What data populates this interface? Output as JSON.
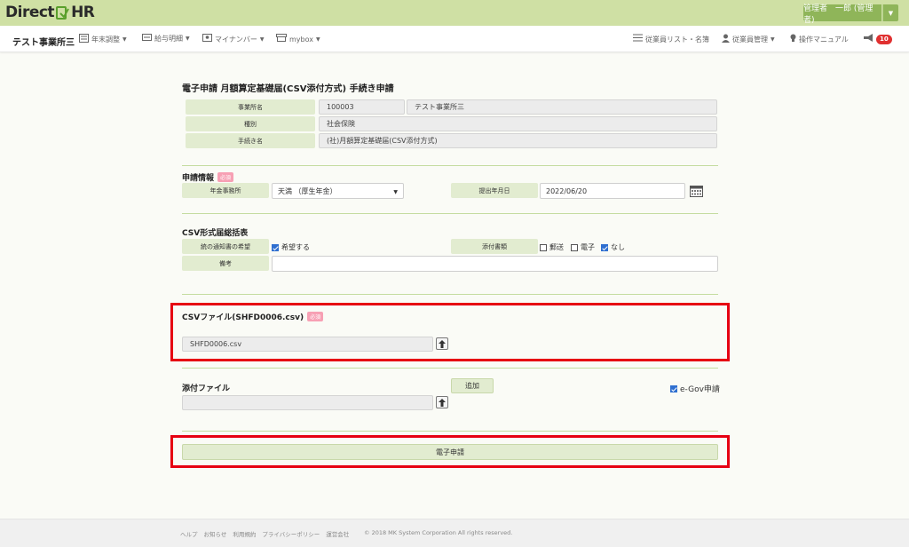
{
  "brand": {
    "logo_left": "Direct",
    "logo_right": "HR"
  },
  "header": {
    "user_label": "管理者　一郎 (管理者)"
  },
  "nav": {
    "company": "テスト事業所三",
    "year_end": "年末調整",
    "payroll": "給与明細",
    "mynumber": "マイナンバー",
    "mybox": "mybox",
    "employee_list": "従業員リスト・名簿",
    "employee_manage": "従業員管理",
    "manual": "操作マニュアル",
    "notification_count": "10"
  },
  "page": {
    "title": "電子申請 月額算定基礎届(CSV添付方式) 手続き申請"
  },
  "summary": {
    "office_label": "事業所名",
    "office_code": "100003",
    "office_name": "テスト事業所三",
    "type_label": "種別",
    "type_value": "社会保険",
    "procedure_label": "手続き名",
    "procedure_value": "(社)月額算定基礎届(CSV添付方式)"
  },
  "apply_info": {
    "title": "申請情報",
    "required": "必須",
    "pension_office_label": "年金事務所",
    "pension_office_value": "天満 （厚生年金）",
    "submit_date_label": "提出年月日",
    "submit_date_value": "2022/06/20"
  },
  "csv_summary": {
    "title": "CSV形式届総括表",
    "notice_label": "統の通知書の希望",
    "notice_option": "希望する",
    "attach_label": "添付書類",
    "attach_mail": "郵送",
    "attach_electronic": "電子",
    "attach_none": "なし",
    "remarks_label": "備考",
    "remarks_value": ""
  },
  "csv_file": {
    "title": "CSVファイル(SHFD0006.csv)",
    "required": "必須",
    "filename": "SHFD0006.csv"
  },
  "attachment": {
    "title": "添付ファイル",
    "add_label": "追加",
    "egov_label": "e-Gov申請",
    "file_value": ""
  },
  "submit": {
    "label": "電子申請"
  },
  "footer": {
    "links": [
      "ヘルプ",
      "お知らせ",
      "利用規約",
      "プライバシーポリシー",
      "運営会社"
    ],
    "copyright": "© 2018 MK System Corporation All rights reserved."
  },
  "colors": {
    "topbar": "#cfe0a4",
    "accent": "#8fb559",
    "label_bg": "#e2ecd0",
    "highlight": "#e60012"
  }
}
